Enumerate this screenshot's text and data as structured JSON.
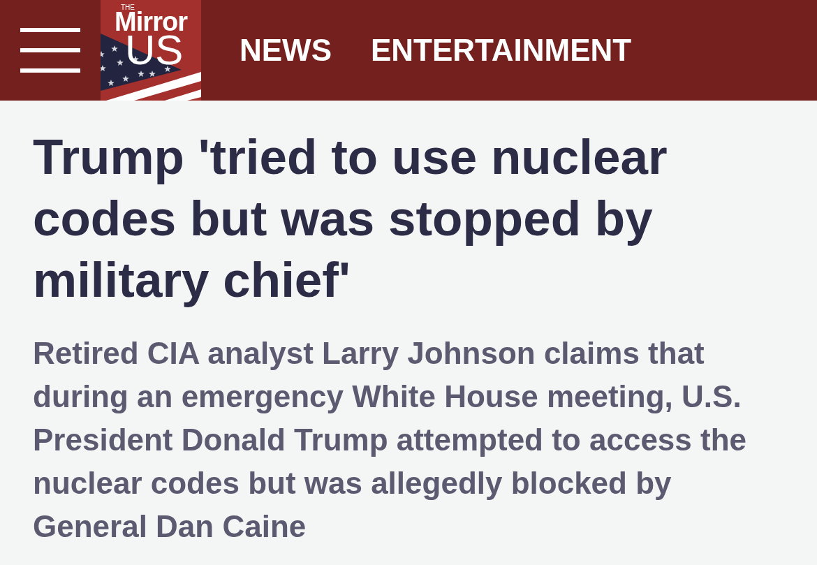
{
  "header": {
    "logo": {
      "small_text": "THE",
      "wordmark": "Mirror",
      "edition": "US"
    },
    "nav": [
      {
        "label": "NEWS"
      },
      {
        "label": "ENTERTAINMENT"
      }
    ]
  },
  "article": {
    "headline": "Trump 'tried to use nuclear codes but was stopped by military chief'",
    "standfirst": "Retired CIA analyst Larry Johnson claims that during an emergency White House meeting, U.S. President Donald Trump attempted to access the nuclear codes but was allegedly blocked by General Dan Caine"
  }
}
